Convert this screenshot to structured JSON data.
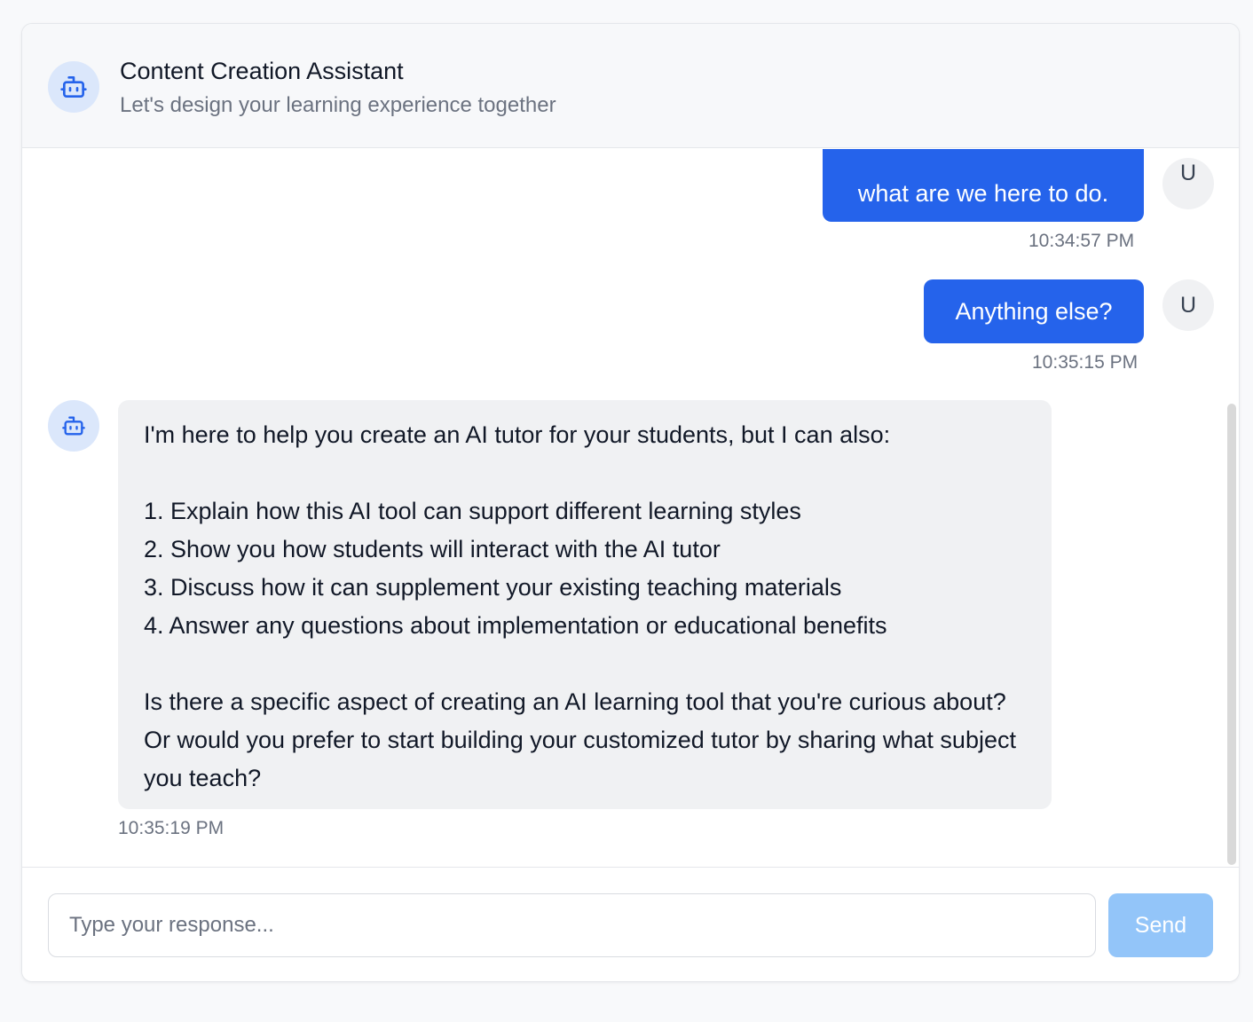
{
  "header": {
    "title": "Content Creation Assistant",
    "subtitle": "Let's design your learning experience together",
    "avatar_icon": "robot-icon"
  },
  "messages": [
    {
      "role": "user",
      "text": "what are we here to do.",
      "time": "10:34:57 PM",
      "avatar": "U"
    },
    {
      "role": "user",
      "text": "Anything else?",
      "time": "10:35:15 PM",
      "avatar": "U"
    },
    {
      "role": "assistant",
      "intro": "I'm here to help you create an AI tutor for your students, but I can also:",
      "list": [
        "1. Explain how this AI tool can support different learning styles",
        "2. Show you how students will interact with the AI tutor",
        "3. Discuss how it can supplement your existing teaching materials",
        "4. Answer any questions about implementation or educational benefits"
      ],
      "closing": "Is there a specific aspect of creating an AI learning tool that you're curious about? Or would you prefer to start building your customized tutor by sharing what subject you teach?",
      "time": "10:35:19 PM",
      "avatar_icon": "robot-icon"
    }
  ],
  "composer": {
    "placeholder": "Type your response...",
    "value": "",
    "send_label": "Send"
  },
  "colors": {
    "accent": "#2563eb",
    "send_disabled": "#93c5f9",
    "bot_bubble": "#f0f1f3",
    "avatar_bg": "#dbe7fb"
  }
}
